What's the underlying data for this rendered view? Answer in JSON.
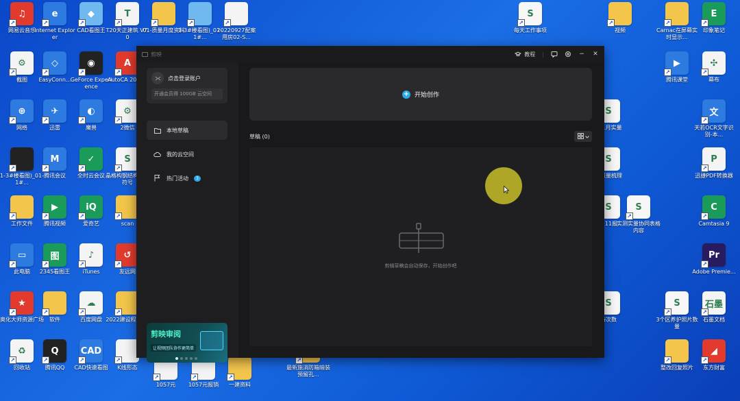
{
  "desktop": {
    "icons": [
      {
        "label": "网易云音乐",
        "icon": "netease-music-icon",
        "color": "#e23b2e",
        "glyph": "♫"
      },
      {
        "label": "Internet Explorer",
        "icon": "ie-icon",
        "color": "#2d7be0",
        "glyph": "e"
      },
      {
        "label": "CAD看图王",
        "icon": "cad-viewer-icon",
        "color": "#6fb8f0",
        "glyph": "◆"
      },
      {
        "label": "T20天正建筑 V7.0",
        "icon": "tangent-icon",
        "color": "#f4f4f4",
        "glyph": "T"
      },
      {
        "label": "01-质量月度资料",
        "icon": "folder-icon",
        "color": "#f3c54b",
        "glyph": ""
      },
      {
        "label": "1-3#楼看图)_01-1#...",
        "icon": "file-icon",
        "color": "#6fb8f0",
        "glyph": ""
      },
      {
        "label": "20220927配案用房02-S...",
        "icon": "image-file-icon",
        "color": "#f4f4f4",
        "glyph": ""
      },
      {
        "label": "截图",
        "icon": "screenshot-icon",
        "color": "#f4f4f4",
        "glyph": "⚙"
      },
      {
        "label": "EasyConn...",
        "icon": "easyconnect-icon",
        "color": "#2d7be0",
        "glyph": "◇"
      },
      {
        "label": "GeForce Experience",
        "icon": "geforce-icon",
        "color": "#222222",
        "glyph": "◉"
      },
      {
        "label": "AutoCA 2020 -",
        "icon": "autocad-icon",
        "color": "#e23b2e",
        "glyph": "A"
      },
      {
        "label": "网络",
        "icon": "network-icon",
        "color": "#2d7be0",
        "glyph": "⊕"
      },
      {
        "label": "迅雷",
        "icon": "xunlei-icon",
        "color": "#2d7be0",
        "glyph": "✈"
      },
      {
        "label": "魔兽",
        "icon": "game-icon",
        "color": "#2d7be0",
        "glyph": "◐"
      },
      {
        "label": "2微信",
        "icon": "wechat-file-icon",
        "color": "#f4f4f4",
        "glyph": "⚙"
      },
      {
        "label": "1-3#楼看图)_01-1#...",
        "icon": "drawing-icon",
        "color": "#222222",
        "glyph": ""
      },
      {
        "label": "腾讯会议",
        "icon": "tencent-meeting-icon",
        "color": "#2d7be0",
        "glyph": "M"
      },
      {
        "label": "全时云会议",
        "icon": "quanshi-icon",
        "color": "#1a9b5a",
        "glyph": "✓"
      },
      {
        "label": "晶格构钢结构安置符号",
        "icon": "excel-icon",
        "color": "#f7f7f7",
        "glyph": "S"
      },
      {
        "label": "工作文件",
        "icon": "folder-icon",
        "color": "#f3c54b",
        "glyph": ""
      },
      {
        "label": "腾讯视频",
        "icon": "tencent-video-icon",
        "color": "#1a9b5a",
        "glyph": "▶"
      },
      {
        "label": "爱奇艺",
        "icon": "iqiyi-icon",
        "color": "#1a9b5a",
        "glyph": "iQ"
      },
      {
        "label": "scan",
        "icon": "folder-icon",
        "color": "#f3c54b",
        "glyph": ""
      },
      {
        "label": "此电脑",
        "icon": "computer-icon",
        "color": "#2d7be0",
        "glyph": "▭"
      },
      {
        "label": "2345看图王",
        "icon": "viewer-2345-icon",
        "color": "#1a9b5a",
        "glyph": "图"
      },
      {
        "label": "iTunes",
        "icon": "itunes-icon",
        "color": "#f4f4f4",
        "glyph": "♪"
      },
      {
        "label": "友远网",
        "icon": "link-icon",
        "color": "#e23b2e",
        "glyph": "↺"
      },
      {
        "label": "奥化大师资源广场",
        "icon": "resource-icon",
        "color": "#e23b2e",
        "glyph": "★"
      },
      {
        "label": "软件",
        "icon": "folder-icon",
        "color": "#f3c54b",
        "glyph": ""
      },
      {
        "label": "百度网盘",
        "icon": "baidu-netdisk-icon",
        "color": "#f4f4f4",
        "glyph": "☁"
      },
      {
        "label": "2022建设程经济-",
        "icon": "folder-icon",
        "color": "#f3c54b",
        "glyph": ""
      },
      {
        "label": "回收站",
        "icon": "recycle-bin-icon",
        "color": "#f4f4f4",
        "glyph": "♻"
      },
      {
        "label": "腾讯QQ",
        "icon": "qq-icon",
        "color": "#222222",
        "glyph": "Q"
      },
      {
        "label": "CAD快速看图",
        "icon": "cad-fast-icon",
        "color": "#2d7be0",
        "glyph": "CAD"
      },
      {
        "label": "K线形态",
        "icon": "kline-icon",
        "color": "#f4f4f4",
        "glyph": ""
      },
      {
        "label": "1057元",
        "icon": "file-icon",
        "color": "#f4f4f4",
        "glyph": ""
      },
      {
        "label": "1057元报销",
        "icon": "file-icon",
        "color": "#f4f4f4",
        "glyph": ""
      },
      {
        "label": "一建资料",
        "icon": "folder-icon",
        "color": "#f3c54b",
        "glyph": ""
      },
      {
        "label": "最新施消防箱暗装预留孔...",
        "icon": "folder-icon",
        "color": "#f3c54b",
        "glyph": ""
      },
      {
        "label": "每天工作事项",
        "icon": "excel-icon",
        "color": "#f7f7f7",
        "glyph": "S"
      },
      {
        "label": "视频",
        "icon": "folder-icon",
        "color": "#f3c54b",
        "glyph": ""
      },
      {
        "label": "Carnac在屏幕实时显示...",
        "icon": "folder-icon",
        "color": "#f3c54b",
        "glyph": ""
      },
      {
        "label": "印象笔记",
        "icon": "evernote-icon",
        "color": "#1a9b5a",
        "glyph": "E"
      },
      {
        "label": "腾讯课堂",
        "icon": "tencent-class-icon",
        "color": "#2d7be0",
        "glyph": "▶"
      },
      {
        "label": "幕布",
        "icon": "mubu-icon",
        "color": "#f4f4f4",
        "glyph": "✣"
      },
      {
        "label": "E11月实量",
        "icon": "excel-icon",
        "color": "#f7f7f7",
        "glyph": "S"
      },
      {
        "label": "天若OCR文字识别-本...",
        "icon": "ocr-icon",
        "color": "#2d7be0",
        "glyph": "文"
      },
      {
        "label": "上报量梳理",
        "icon": "excel-icon",
        "color": "#f7f7f7",
        "glyph": "S"
      },
      {
        "label": "迅捷PDF转换器",
        "icon": "pdf-converter-icon",
        "color": "#f4f4f4",
        "glyph": "P"
      },
      {
        "label": "报11报",
        "icon": "excel-icon",
        "color": "#f7f7f7",
        "glyph": "S"
      },
      {
        "label": "实测实量协同表格内容",
        "icon": "excel-icon",
        "color": "#f7f7f7",
        "glyph": "S"
      },
      {
        "label": "Camtasia 9",
        "icon": "camtasia-icon",
        "color": "#1a9b5a",
        "glyph": "C"
      },
      {
        "label": "Adobe Premie...",
        "icon": "premiere-icon",
        "color": "#2a1a5e",
        "glyph": "Pr"
      },
      {
        "label": "待次数",
        "icon": "excel-icon",
        "color": "#f7f7f7",
        "glyph": "S"
      },
      {
        "label": "3个区养护照片数量",
        "icon": "excel-icon",
        "color": "#f7f7f7",
        "glyph": "S"
      },
      {
        "label": "石墨文档",
        "icon": "shimo-icon",
        "color": "#f4f4f4",
        "glyph": "石墨"
      },
      {
        "label": "整改回复照片",
        "icon": "folder-icon",
        "color": "#f3c54b",
        "glyph": ""
      },
      {
        "label": "东方财富",
        "icon": "eastmoney-icon",
        "color": "#e23b2e",
        "glyph": "◢"
      }
    ]
  },
  "window": {
    "title": "剪映",
    "tutorial_label": "教程",
    "minimize_glyph": "−",
    "close_glyph": "✕"
  },
  "sidebar": {
    "login_label": "点击登录账户",
    "promo_text": "开通会员得 100GB 云空间",
    "nav": [
      {
        "label": "本地草稿",
        "icon": "folder-icon",
        "active": true
      },
      {
        "label": "我的云空间",
        "icon": "cloud-icon",
        "active": false
      },
      {
        "label": "热门活动",
        "icon": "flag-icon",
        "active": false,
        "badge": "3"
      }
    ],
    "banner": {
      "title": "剪映审阅",
      "subtitle": "让视频团队协作更简单"
    }
  },
  "main": {
    "create_label": "开始创作",
    "drafts_title": "草稿 (0)",
    "empty_text": "剪辑草稿会自动保存，开始创作吧"
  },
  "colors": {
    "accent": "#2aa8e8",
    "window_bg": "#1b1b1d",
    "card_bg": "#2a2a2d",
    "cursor_highlight": "#c8be28"
  }
}
